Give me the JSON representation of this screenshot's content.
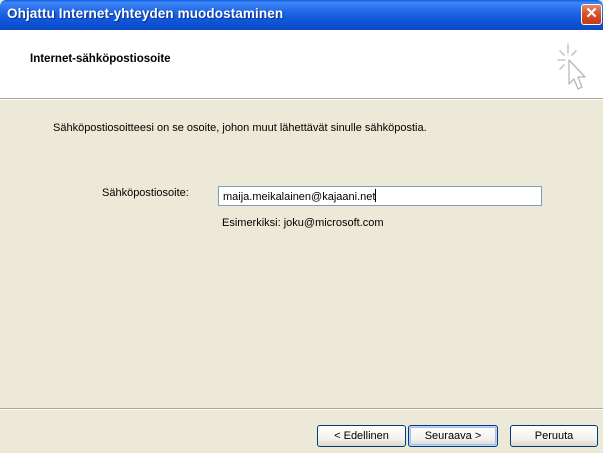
{
  "window": {
    "title": "Ohjattu Internet-yhteyden muodostaminen",
    "close_glyph": "✕"
  },
  "header": {
    "title": "Internet-sähköpostiosoite",
    "icon": "wizard-cursor-icon"
  },
  "body": {
    "description": "Sähköpostiosoitteesi on se osoite, johon muut lähettävät sinulle sähköpostia.",
    "email_label": "Sähköpostiosoite:",
    "email_value": "maija.meikalainen@kajaani.net",
    "example": "Esimerkiksi: joku@microsoft.com"
  },
  "footer": {
    "back_label": "< Edellinen",
    "next_label": "Seuraava >",
    "cancel_label": "Peruuta"
  },
  "colors": {
    "titlebar": "#0a5ee0",
    "dialog_bg": "#ece9d8",
    "header_bg": "#ffffff",
    "close_button": "#d4522e"
  }
}
